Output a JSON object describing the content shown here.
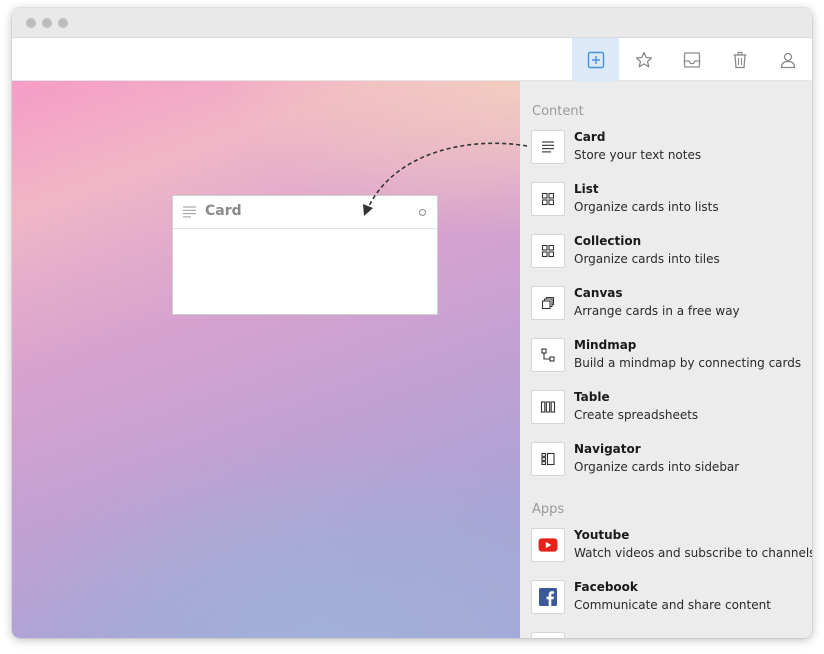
{
  "window": {
    "toolbar": {
      "buttons": [
        {
          "name": "add",
          "icon": "plus-icon",
          "active": true
        },
        {
          "name": "favorite",
          "icon": "star-icon",
          "active": false
        },
        {
          "name": "inbox",
          "icon": "inbox-icon",
          "active": false
        },
        {
          "name": "trash",
          "icon": "trash-icon",
          "active": false
        },
        {
          "name": "profile",
          "icon": "user-icon",
          "active": false
        }
      ],
      "active_color": "#dbe9f8"
    }
  },
  "canvas": {
    "card": {
      "title": "Card",
      "icon": "text-lines-icon"
    }
  },
  "panel": {
    "content_section": "Content",
    "apps_section": "Apps",
    "content_items": [
      {
        "title": "Card",
        "desc": "Store your text notes",
        "icon": "text-lines-icon"
      },
      {
        "title": "List",
        "desc": "Organize cards into lists",
        "icon": "grid-icon"
      },
      {
        "title": "Collection",
        "desc": "Organize cards into tiles",
        "icon": "grid-icon"
      },
      {
        "title": "Canvas",
        "desc": "Arrange cards in a free way",
        "icon": "stacked-squares-icon"
      },
      {
        "title": "Mindmap",
        "desc": "Build a mindmap by connecting cards",
        "icon": "mindmap-icon"
      },
      {
        "title": "Table",
        "desc": "Create spreadsheets",
        "icon": "columns-icon"
      },
      {
        "title": "Navigator",
        "desc": "Organize cards into sidebar",
        "icon": "sidebar-icon"
      }
    ],
    "app_items": [
      {
        "title": "Youtube",
        "desc": "Watch videos and subscribe to channels",
        "icon": "youtube-icon",
        "color": "#e62117"
      },
      {
        "title": "Facebook",
        "desc": "Communicate and share content",
        "icon": "facebook-icon",
        "color": "#3b5998"
      }
    ]
  }
}
